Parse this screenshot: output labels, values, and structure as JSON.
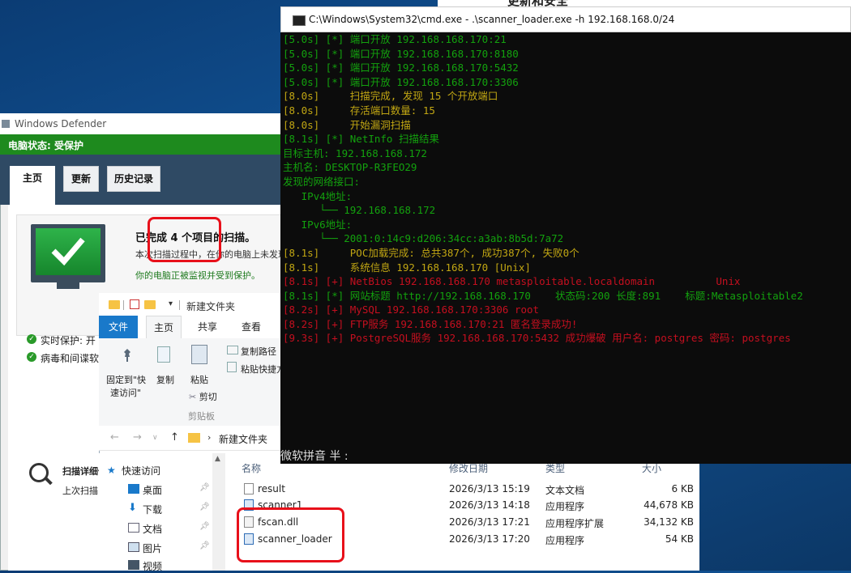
{
  "security_center": {
    "title": "更新和安全"
  },
  "defender": {
    "title": "Windows Defender",
    "status": "电脑状态: 受保护",
    "tabs": {
      "home": "主页",
      "update": "更新",
      "history": "历史记录"
    },
    "scan_done": "已完成 4 个项目的扫描。",
    "scan_sub": "本次扫描过程中，在你的电脑上未发现任何威胁。",
    "scan_monitor": "你的电脑正被监视并受到保护。",
    "items": [
      "实时保护: 开",
      "病毒和间谍软件定义: 最新"
    ],
    "scan_details": {
      "title": "扫描详细信息",
      "last": "上次扫描: 今天"
    }
  },
  "explorer": {
    "qat_title": "新建文件夹",
    "menu": {
      "file": "文件",
      "home": "主页",
      "share": "共享",
      "view": "查看"
    },
    "ribbon": {
      "pin": "固定到\"快",
      "pin2": "速访问\"",
      "copy": "复制",
      "paste": "粘贴",
      "cut": "剪切",
      "copy_path": "复制路径",
      "paste_shortcut": "粘贴快捷方式",
      "group": "剪贴板"
    },
    "breadcrumb": "新建文件夹",
    "nav": [
      "快速访问",
      "桌面",
      "下载",
      "文档",
      "图片",
      "视频"
    ],
    "columns": {
      "name": "名称",
      "date": "修改日期",
      "type": "类型",
      "size": "大小"
    },
    "files": [
      {
        "name": "result",
        "date": "2026/3/13 15:19",
        "type": "文本文档",
        "size": "6 KB",
        "icon": "txt-file-icon"
      },
      {
        "name": "scanner1",
        "date": "2026/3/13 14:18",
        "type": "应用程序",
        "size": "44,678 KB",
        "icon": "exe-file-icon"
      },
      {
        "name": "fscan.dll",
        "date": "2026/3/13 17:21",
        "type": "应用程序扩展",
        "size": "34,132 KB",
        "icon": "dll-file-icon"
      },
      {
        "name": "scanner_loader",
        "date": "2026/3/13 17:20",
        "type": "应用程序",
        "size": "54 KB",
        "icon": "exe-file-icon"
      }
    ]
  },
  "cmd": {
    "title": "C:\\Windows\\System32\\cmd.exe - .\\scanner_loader.exe  -h 192.168.168.0/24",
    "colors": {
      "green": "#13a10e",
      "yellow": "#c1a613",
      "red": "#c50f1f"
    },
    "lines": [
      {
        "c": "g",
        "t": "[5.0s] [*] 端口开放 192.168.168.170:21"
      },
      {
        "c": "g",
        "t": "[5.0s] [*] 端口开放 192.168.168.170:8180"
      },
      {
        "c": "g",
        "t": "[5.0s] [*] 端口开放 192.168.168.170:5432"
      },
      {
        "c": "g",
        "t": "[5.0s] [*] 端口开放 192.168.168.170:3306"
      },
      {
        "c": "y",
        "t": "[8.0s]     扫描完成, 发现 15 个开放端口"
      },
      {
        "c": "y",
        "t": "[8.0s]     存活端口数量: 15"
      },
      {
        "c": "y",
        "t": "[8.0s]     开始漏洞扫描"
      },
      {
        "c": "g",
        "t": "[8.1s] [*] NetInfo 扫描结果"
      },
      {
        "c": "g",
        "t": "目标主机: 192.168.168.172"
      },
      {
        "c": "g",
        "t": "主机名: DESKTOP-R3FEO29"
      },
      {
        "c": "g",
        "t": "发现的网络接口:"
      },
      {
        "c": "g",
        "t": "   IPv4地址:"
      },
      {
        "c": "g",
        "t": "      └── 192.168.168.172"
      },
      {
        "c": "g",
        "t": "   IPv6地址:"
      },
      {
        "c": "g",
        "t": "      └── 2001:0:14c9:d206:34cc:a3ab:8b5d:7a72"
      },
      {
        "c": "y",
        "t": "[8.1s]     POC加载完成: 总共387个, 成功387个, 失败0个"
      },
      {
        "c": "y",
        "t": "[8.1s]     系统信息 192.168.168.170 [Unix]"
      },
      {
        "c": "r",
        "t": "[8.1s] [+] NetBios 192.168.168.170 metasploitable.localdomain          Unix"
      },
      {
        "c": "g",
        "t": "[8.1s] [*] 网站标题 http://192.168.168.170    状态码:200 长度:891    标题:Metasploitable2"
      },
      {
        "c": "r",
        "t": "[8.2s] [+] MySQL 192.168.168.170:3306 root"
      },
      {
        "c": "r",
        "t": "[8.2s] [+] FTP服务 192.168.168.170:21 匿名登录成功!"
      },
      {
        "c": "r",
        "t": "[9.3s] [+] PostgreSQL服务 192.168.168.170:5432 成功爆破 用户名: postgres 密码: postgres"
      }
    ],
    "ime": "微软拼音 半 :"
  }
}
